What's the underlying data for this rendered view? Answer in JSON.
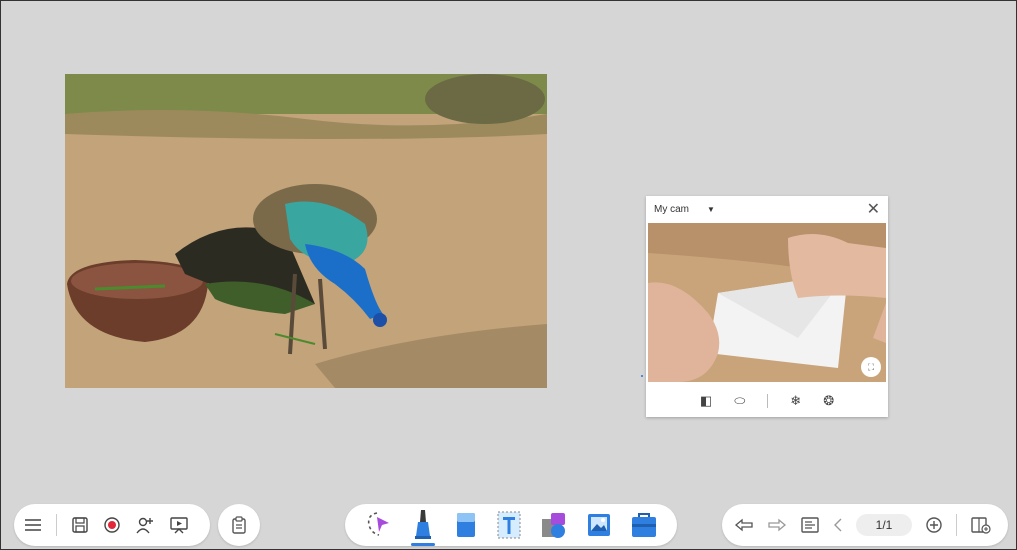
{
  "camera": {
    "title": "My cam",
    "dropdown_icon": "caret-down-icon",
    "close_icon": "close-icon",
    "fullscreen_icon": "fullscreen-icon",
    "controls": [
      "mirror-icon",
      "rotate-icon",
      "freeze-icon",
      "settings-icon"
    ]
  },
  "toolbar_left": {
    "items": [
      "menu-icon",
      "save-icon",
      "record-icon",
      "add-user-icon",
      "present-icon"
    ]
  },
  "toolbar_paste": {
    "icon": "clipboard-icon"
  },
  "toolbar_center": {
    "items": [
      "select-tool",
      "pen-tool",
      "eraser-tool",
      "text-tool",
      "shape-tool",
      "image-tool",
      "toolbox-tool"
    ],
    "active": "pen-tool"
  },
  "toolbar_right": {
    "undo_icon": "undo-icon",
    "redo_icon": "redo-icon",
    "pages_icon": "pages-icon",
    "prev_icon": "chevron-left-icon",
    "page_indicator": "1/1",
    "add_page_icon": "plus-circle-icon",
    "board_icon": "board-add-icon"
  },
  "colors": {
    "accent": "#2f7fe0",
    "record": "#e0283a",
    "background": "#d6d6d6"
  }
}
